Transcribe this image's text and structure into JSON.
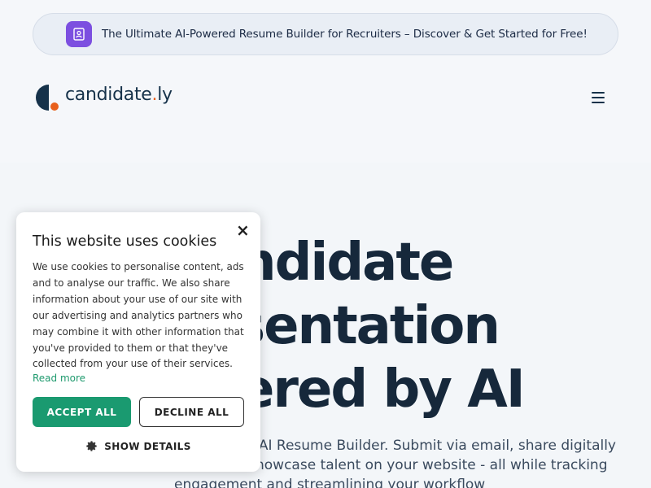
{
  "announcement": {
    "text": "The Ultimate AI-Powered Resume Builder for Recruiters – Discover & Get Started for Free!",
    "icon": "resume-icon",
    "icon_color": "#7c4fe0"
  },
  "header": {
    "brand_name": "candidate",
    "brand_dot": ".",
    "brand_suffix": "ly",
    "brand_color": "#16324a",
    "accent_color": "#e8601c",
    "menu_icon": "hamburger-menu-icon"
  },
  "hero": {
    "title_lines": [
      "ndidate",
      "sentation",
      "ered by AI"
    ],
    "subtitle_lines": [
      "e AI Resume Builder. Submit via email, share digitally",
      "howcase talent on your website - all while tracking",
      "engagement and streamlining your workflow"
    ]
  },
  "cookie_banner": {
    "title": "This website uses cookies",
    "body": "We use cookies to personalise content, ads and to analyse our traffic. We also share information about your use of our site with our advertising and analytics partners who may combine it with other information that you've provided to them or that they've collected from your use of their services.",
    "read_more": "Read more",
    "accept_label": "ACCEPT ALL",
    "decline_label": "DECLINE ALL",
    "details_label": "SHOW DETAILS",
    "accept_color": "#1a9a70"
  }
}
